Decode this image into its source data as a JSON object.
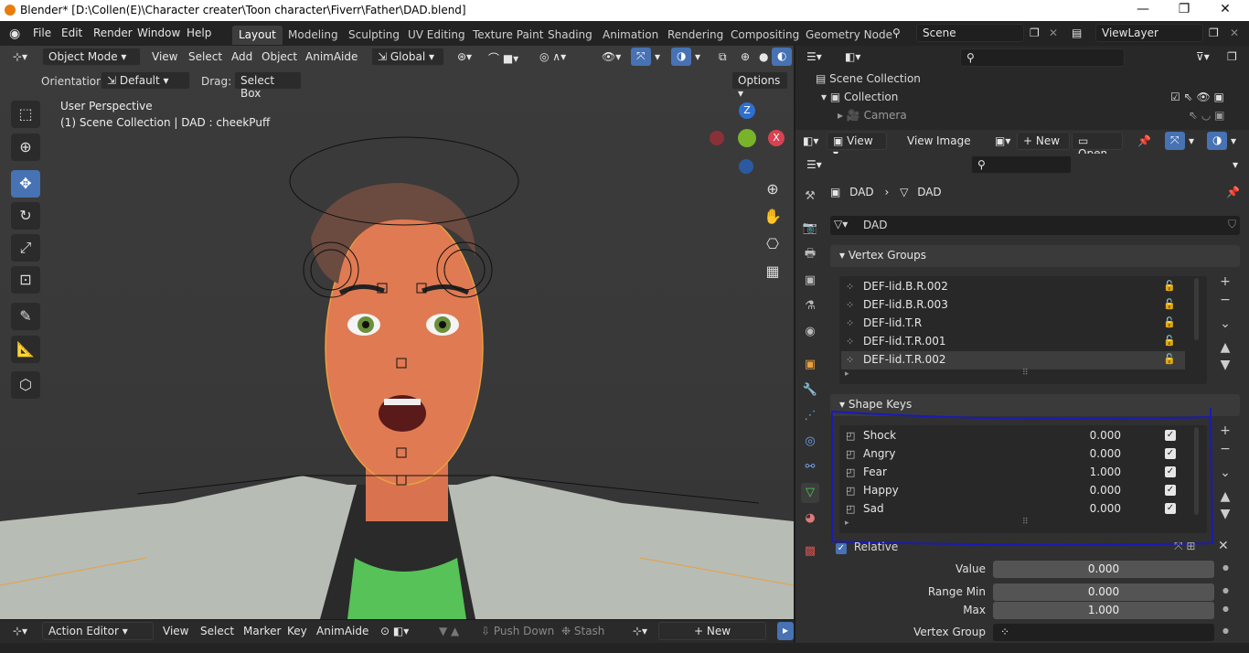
{
  "titlebar": {
    "title": "Blender* [D:\\Collen(E)\\Character creater\\Toon character\\Fiverr\\Father\\DAD.blend]",
    "minimize": "—",
    "restore": "❐",
    "close": "✕"
  },
  "menu": {
    "items": [
      "File",
      "Edit",
      "Render",
      "Window",
      "Help"
    ]
  },
  "workspaces": [
    "Layout",
    "Modeling",
    "Sculpting",
    "UV Editing",
    "Texture Paint",
    "Shading",
    "Animation",
    "Rendering",
    "Compositing",
    "Geometry Node"
  ],
  "scene": {
    "name": "Scene",
    "view_layer": "ViewLayer"
  },
  "viewport_header": {
    "mode": "Object Mode",
    "menus": [
      "View",
      "Select",
      "Add",
      "Object",
      "AnimAide"
    ],
    "transform": "Global",
    "orientation_label": "Orientation:",
    "orientation_value": "Default",
    "drag_label": "Drag:",
    "drag_value": "Select Box",
    "options": "Options"
  },
  "viewport_overlay": {
    "line1": "User Perspective",
    "line2": "(1) Scene Collection | DAD : cheekPuff"
  },
  "gizmo": {
    "z": "Z",
    "x": "X"
  },
  "outliner": {
    "scene_collection": "Scene Collection",
    "collection": "Collection",
    "camera": "Camera"
  },
  "image_editor": {
    "view": "View",
    "menus": [
      "View",
      "Image"
    ],
    "new": "New",
    "open": "Open"
  },
  "properties": {
    "breadcrumb_object": "DAD",
    "breadcrumb_mesh": "DAD",
    "mesh_name": "DAD",
    "vertex_groups_title": "Vertex Groups",
    "vertex_groups": [
      "DEF-lid.B.R.002",
      "DEF-lid.B.R.003",
      "DEF-lid.T.R",
      "DEF-lid.T.R.001",
      "DEF-lid.T.R.002"
    ],
    "shape_keys_title": "Shape Keys",
    "shape_keys": [
      {
        "name": "Shock",
        "value": "0.000"
      },
      {
        "name": "Angry",
        "value": "0.000"
      },
      {
        "name": "Fear",
        "value": "1.000"
      },
      {
        "name": "Happy",
        "value": "0.000"
      },
      {
        "name": "Sad",
        "value": "0.000"
      }
    ],
    "relative_label": "Relative",
    "value_label": "Value",
    "value": "0.000",
    "range_min_label": "Range Min",
    "range_min": "0.000",
    "max_label": "Max",
    "max": "1.000",
    "vertex_group_label": "Vertex Group"
  },
  "bottom_editor": {
    "type": "Action Editor",
    "menus": [
      "View",
      "Select",
      "Marker",
      "Key",
      "AnimAide"
    ],
    "push_down": "Push Down",
    "stash": "Stash",
    "new": "New"
  },
  "colors": {
    "accent": "#4772b3",
    "selection_outline": "#e8a040",
    "annotation": "#1a1ab8"
  }
}
